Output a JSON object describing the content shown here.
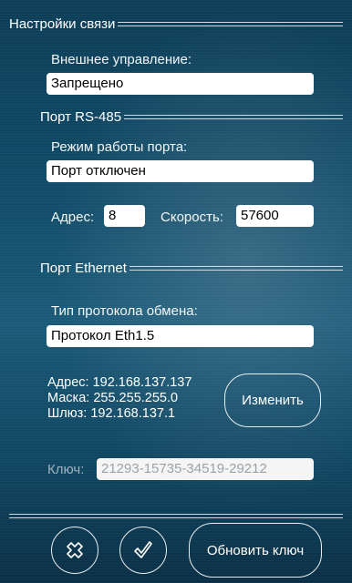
{
  "sections": {
    "comm": "Настройки связи",
    "rs485": "Порт RS-485",
    "ethernet": "Порт Ethernet"
  },
  "external_control": {
    "label": "Внешнее управление:",
    "value": "Запрещено"
  },
  "port_mode": {
    "label": "Режим работы порта:",
    "value": "Порт отключен"
  },
  "address": {
    "label": "Адрес:",
    "value": "8"
  },
  "speed": {
    "label": "Скорость:",
    "value": "57600"
  },
  "protocol": {
    "label": "Тип протокола обмена:",
    "value": "Протокол Eth1.5"
  },
  "eth_info": {
    "address": "Адрес: 192.168.137.137",
    "mask": "Маска: 255.255.255.0",
    "gateway": "Шлюз: 192.168.137.1"
  },
  "change_button": "Изменить",
  "key": {
    "label": "Ключ:",
    "value": "21293-15735-34519-29212"
  },
  "buttons": {
    "cancel_icon": "cross-icon",
    "ok_icon": "check-icon",
    "update_key": "Обновить ключ"
  }
}
